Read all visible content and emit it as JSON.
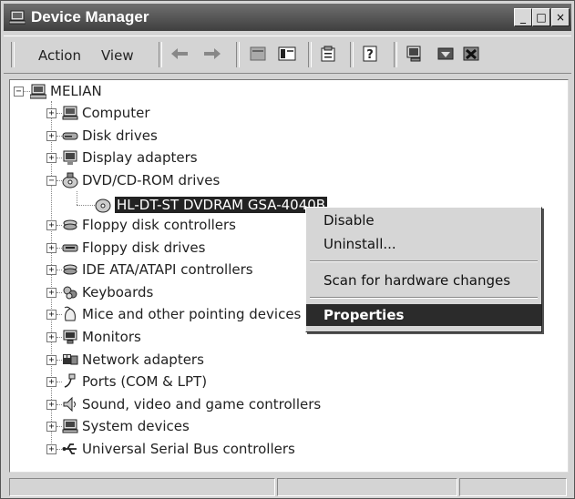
{
  "window": {
    "title": "Device Manager"
  },
  "title_buttons": {
    "minimize": "_",
    "maximize": "□",
    "close": "×"
  },
  "menu": {
    "action": "Action",
    "view": "View"
  },
  "toolbar_icons": [
    "back-arrow-icon",
    "forward-arrow-icon",
    "folder-tree-icon",
    "console-icon",
    "properties-icon",
    "help-icon",
    "scan-hardware-icon",
    "update-driver-icon",
    "uninstall-icon"
  ],
  "tree": {
    "root": "MELIAN",
    "items": [
      {
        "label": "Computer",
        "icon": "computer-icon",
        "expanded": false
      },
      {
        "label": "Disk drives",
        "icon": "disk-drive-icon",
        "expanded": false
      },
      {
        "label": "Display adapters",
        "icon": "display-adapter-icon",
        "expanded": false
      },
      {
        "label": "DVD/CD-ROM drives",
        "icon": "cdrom-icon",
        "expanded": true
      },
      {
        "label": "Floppy disk controllers",
        "icon": "controller-icon",
        "expanded": false
      },
      {
        "label": "Floppy disk drives",
        "icon": "floppy-icon",
        "expanded": false
      },
      {
        "label": "IDE ATA/ATAPI controllers",
        "icon": "ide-controller-icon",
        "expanded": false
      },
      {
        "label": "Keyboards",
        "icon": "keyboard-icon",
        "expanded": false
      },
      {
        "label": "Mice and other pointing devices",
        "icon": "mouse-icon",
        "expanded": false
      },
      {
        "label": "Monitors",
        "icon": "monitor-icon",
        "expanded": false
      },
      {
        "label": "Network adapters",
        "icon": "network-adapter-icon",
        "expanded": false
      },
      {
        "label": "Ports (COM & LPT)",
        "icon": "port-icon",
        "expanded": false
      },
      {
        "label": "Sound, video and game controllers",
        "icon": "sound-icon",
        "expanded": false
      },
      {
        "label": "System devices",
        "icon": "system-device-icon",
        "expanded": false
      },
      {
        "label": "Universal Serial Bus controllers",
        "icon": "usb-icon",
        "expanded": false
      }
    ],
    "child_device": "HL-DT-ST DVDRAM GSA-4040B"
  },
  "context_menu": {
    "disable": "Disable",
    "uninstall": "Uninstall...",
    "scan": "Scan for hardware changes",
    "properties": "Properties"
  },
  "colors": {
    "titlebar": "#4a4a4a",
    "selection": "#222222",
    "face": "#d4d4d4"
  }
}
